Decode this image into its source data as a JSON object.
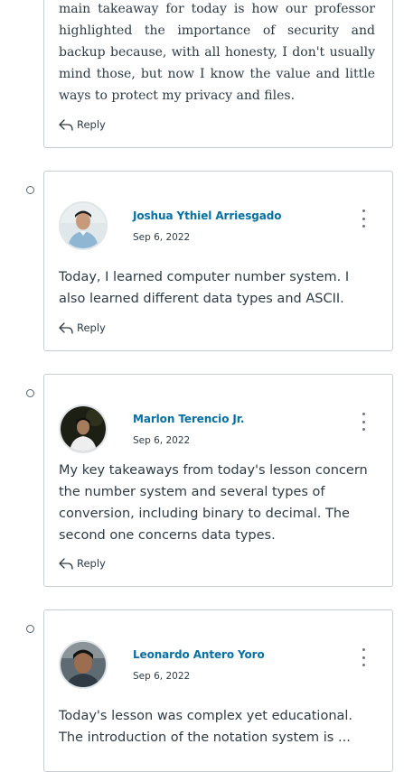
{
  "posts": [
    {
      "body": "main takeaway for today is how our professor highlighted the importance of security and backup because, with all honesty, I don't usually mind those, but now I know the value and little ways to protect my privacy and files.",
      "reply_label": "Reply"
    },
    {
      "author": "Joshua Ythiel Arriesgado",
      "date": "Sep 6, 2022",
      "body": "Today, I learned computer number system. I also learned different data types and ASCII.",
      "reply_label": "Reply"
    },
    {
      "author": "Marlon Terencio Jr.",
      "date": "Sep 6, 2022",
      "body": "My key takeaways from today's lesson concern the number system and several types of conversion, including binary to decimal. The second one concerns data types.",
      "reply_label": "Reply"
    },
    {
      "author": "Leonardo Antero Yoro",
      "date": "Sep 6, 2022",
      "body": "Today's lesson was complex yet educational. The introduction of the notation system is ...",
      "reply_label": "Reply"
    }
  ],
  "colors": {
    "link": "#0770a3",
    "text": "#2d3b45",
    "border": "#c7cdd1"
  },
  "icons": {
    "reply": "reply-arrow-icon",
    "menu": "kebab-menu-icon",
    "unread": "unread-circle-icon"
  }
}
